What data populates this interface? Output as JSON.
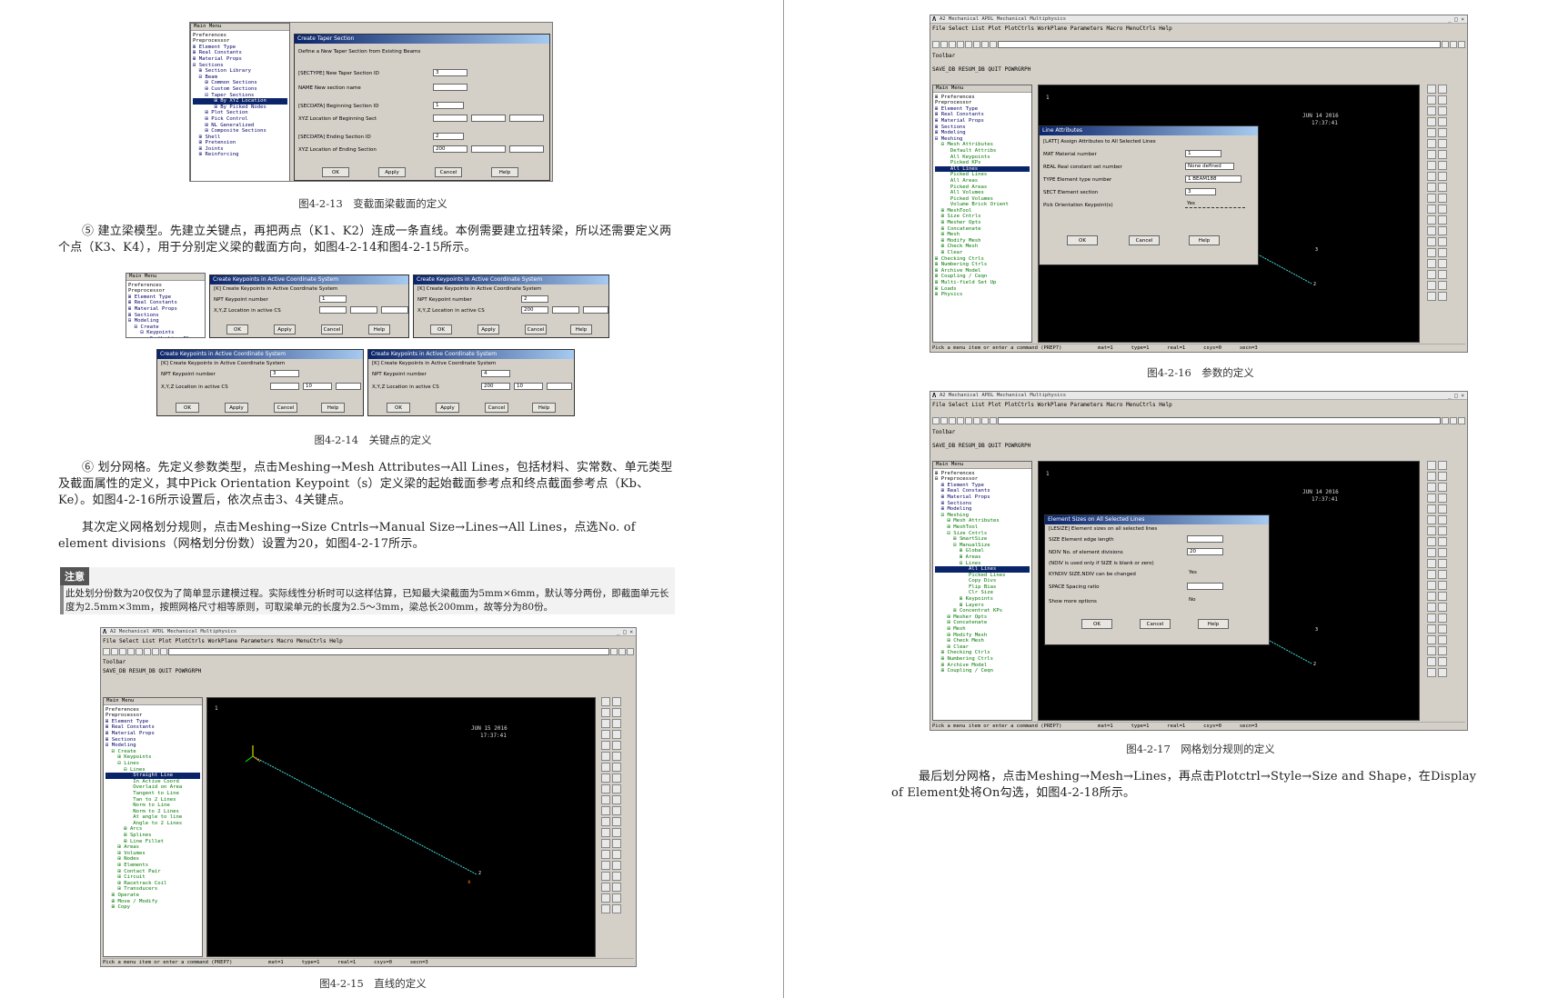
{
  "figures": {
    "f13": "图4-2-13　变截面梁截面的定义",
    "f14": "图4-2-14　关键点的定义",
    "f15": "图4-2-15　直线的定义",
    "f16": "图4-2-16　参数的定义",
    "f17": "图4-2-17　网格划分规则的定义"
  },
  "paragraphs": {
    "p5": "⑤ 建立梁模型。先建立关键点，再把两点（K1、K2）连成一条直线。本例需要建立扭转梁，所以还需要定义两个点（K3、K4），用于分别定义梁的截面方向，如图4-2-14和图4-2-15所示。",
    "p6": "⑥ 划分网格。先定义参数类型，点击Meshing→Mesh Attributes→All Lines，包括材料、实常数、单元类型及截面属性的定义，其中Pick Orientation Keypoint（s）定义梁的起始截面参考点和终点截面参考点（Kb、Ke）。如图4-2-16所示设置后，依次点击3、4关键点。",
    "p7": "其次定义网格划分规则，点击Meshing→Size Cntrls→Manual Size→Lines→All Lines，点选No. of element divisions（网格划分份数）设置为20，如图4-2-17所示。",
    "p8": "最后划分网格，点击Meshing→Mesh→Lines，再点击Plotctrl→Style→Size and Shape，在Display of Element处将On勾选，如图4-2-18所示。"
  },
  "note": {
    "tag": "注意",
    "text": "此处划分份数为20仅仅为了简单显示建模过程。实际线性分析时可以这样估算，已知最大梁截面为5mm×6mm，默认等分两份，即截面单元长度为2.5mm×3mm，按照网格尺寸相等原则，可取梁单元的长度为2.5～3mm，梁总长200mm，故等分为80份。"
  },
  "ansys": {
    "title": "A2 Mechanical APDL Mechanical Multiphysics",
    "menu": "File  Select  List  Plot  PlotCtrls  WorkPlane  Parameters  Macro  MenuCtrls  Help",
    "toolbar_label": "Toolbar",
    "toolbar_buttons": "SAVE_DB  RESUM_DB  QUIT  POWRGRPH",
    "main_menu": "Main Menu",
    "status": "Pick a menu item or enter a command  (PREP7)",
    "status_mat": "mat=1",
    "status_type": "type=1",
    "status_real": "real=1",
    "status_csys": "csys=0",
    "status_secn": "secn=3",
    "gfx_num": "1",
    "gfx_date": "JUN 14 2016",
    "gfx_date2": "JUN 15 2016",
    "gfx_time": "17:37:41"
  },
  "tree13": [
    "Preferences",
    "Preprocessor",
    "⊞ Element Type",
    "⊞ Real Constants",
    "⊞ Material Props",
    "⊟ Sections",
    "  ⊞ Section Library",
    "  ⊟ Beam",
    "    ⊞ Common Sections",
    "    ⊞ Custom Sections",
    "    ⊟ Taper Sections",
    "       ⊞ By XYZ Location",
    "       ⊞ By Picked Nodes",
    "    ⊞ Plot Section",
    "    ⊞ Pick Control",
    "    ⊞ NL Generalized",
    "    ⊞ Composite Sections",
    "  ⊞ Shell",
    "  ⊞ Pretension",
    "  ⊞ Joints",
    "  ⊞ Reinforcing"
  ],
  "dlg13": {
    "title": "Create Taper Section",
    "sub": "Define a New Taper Section from Existing Beams",
    "r1": "[SECTYPE] New Taper Section ID",
    "v1": "3",
    "r2": "NAME   New section name",
    "r3": "[SECDATA] Beginning Section ID",
    "v3": "1",
    "r4": "XYZ Location of Beginning Sect",
    "r5": "[SECDATA] Ending Section ID",
    "v5": "2",
    "r6": "XYZ Location of Ending Section",
    "v6": "200",
    "ok": "OK",
    "apply": "Apply",
    "cancel": "Cancel",
    "help": "Help"
  },
  "tree14": [
    "Preferences",
    "Preprocessor",
    "⊞ Element Type",
    "⊞ Real Constants",
    "⊞ Material Props",
    "⊞ Sections",
    "⊟ Modeling",
    "  ⊟ Create",
    "    ⊟ Keypoints",
    "       On Working Plane",
    "       In Active CS"
  ],
  "dlg14": {
    "title": "Create Keypoints in Active Coordinate System",
    "sub": "[K]  Create Keypoints in Active Coordinate System",
    "npt": "NPT   Keypoint number",
    "xyz": "X,Y,Z  Location in active CS",
    "k1": "1",
    "k2": "2",
    "k2x": "200",
    "k3": "3",
    "k3y": "10",
    "k4": "4",
    "k4x": "200",
    "k4y": "10",
    "ok": "OK",
    "apply": "Apply",
    "cancel": "Cancel",
    "help": "Help"
  },
  "tree15": [
    "Preferences",
    "Preprocessor",
    "⊞ Element Type",
    "⊞ Real Constants",
    "⊞ Material Props",
    "⊞ Sections",
    "⊟ Modeling",
    "  ⊟ Create",
    "    ⊞ Keypoints",
    "    ⊟ Lines",
    "      ⊟ Lines",
    "         Straight Line",
    "         In Active Coord",
    "         Overlaid on Area",
    "         Tangent to Line",
    "         Tan to 2 Lines",
    "         Norm to Line",
    "         Norm to 2 Lines",
    "         At angle to line",
    "         Angle to 2 Lines",
    "      ⊞ Arcs",
    "      ⊞ Splines",
    "      ⊞ Line Fillet",
    "    ⊞ Areas",
    "    ⊞ Volumes",
    "    ⊞ Nodes",
    "    ⊞ Elements",
    "    ⊞ Contact Pair",
    "    ⊞ Circuit",
    "    ⊞ Racetrack Coil",
    "    ⊞ Transducers",
    "  ⊞ Operate",
    "  ⊞ Move / Modify",
    "  ⊞ Copy"
  ],
  "tree16": [
    "⊞ Preferences",
    "Preprocessor",
    "⊞ Element Type",
    "⊞ Real Constants",
    "⊞ Material Props",
    "⊞ Sections",
    "⊞ Modeling",
    "⊟ Meshing",
    "  ⊟ Mesh Attributes",
    "     Default Attribs",
    "     All Keypoints",
    "     Picked KPs",
    "     All Lines",
    "     Picked Lines",
    "     All Areas",
    "     Picked Areas",
    "     All Volumes",
    "     Picked Volumes",
    "     Volume Brick Orient",
    "  ⊞ MeshTool",
    "  ⊞ Size Cntrls",
    "  ⊞ Mesher Opts",
    "  ⊞ Concatenate",
    "  ⊞ Mesh",
    "  ⊞ Modify Mesh",
    "  ⊞ Check Mesh",
    "  ⊞ Clear",
    "⊞ Checking Ctrls",
    "⊞ Numbering Ctrls",
    "⊞ Archive Model",
    "⊞ Coupling / Ceqn",
    "⊞ Multi-field Set Up",
    "⊞ Loads",
    "⊞ Physics"
  ],
  "dlg16": {
    "title": "Line Attributes",
    "sub": "[LATT]  Assign Attributes to All Selected Lines",
    "r1": "MAT   Material number",
    "v1": "1",
    "r2": "REAL  Real constant set number",
    "v2": "None defined",
    "r3": "TYPE  Element type number",
    "v3": "1  BEAM188",
    "r4": "SECT  Element section",
    "v4": "3",
    "r5": "Pick Orientation Keypoint(s)",
    "v5": "Yes",
    "ok": "OK",
    "cancel": "Cancel",
    "help": "Help"
  },
  "tree17": [
    "⊞ Preferences",
    "⊟ Preprocessor",
    "  ⊞ Element Type",
    "  ⊞ Real Constants",
    "  ⊞ Material Props",
    "  ⊞ Sections",
    "  ⊞ Modeling",
    "  ⊟ Meshing",
    "    ⊞ Mesh Attributes",
    "    ⊞ MeshTool",
    "    ⊟ Size Cntrls",
    "      ⊞ SmartSize",
    "      ⊟ ManualSize",
    "        ⊞ Global",
    "        ⊞ Areas",
    "        ⊟ Lines",
    "           All Lines",
    "           Picked Lines",
    "           Copy Divs",
    "           Flip Bias",
    "           Clr Size",
    "        ⊞ Keypoints",
    "        ⊞ Layers",
    "      ⊞ Concentrat KPs",
    "    ⊞ Mesher Opts",
    "    ⊞ Concatenate",
    "    ⊞ Mesh",
    "    ⊞ Modify Mesh",
    "    ⊞ Check Mesh",
    "    ⊞ Clear",
    "  ⊞ Checking Ctrls",
    "  ⊞ Numbering Ctrls",
    "  ⊞ Archive Model",
    "  ⊞ Coupling / Ceqn"
  ],
  "dlg17": {
    "title": "Element Sizes on All Selected Lines",
    "sub": "[LESIZE] Element sizes on all selected lines",
    "r1": "SIZE   Element edge length",
    "r2": "NDIV   No. of element divisions",
    "v2": "20",
    "r3": "(NDIV is used only if SIZE is blank or zero)",
    "r4": "KYNDIV SIZE,NDIV can be changed",
    "v4": "Yes",
    "r5": "SPACE  Spacing ratio",
    "r6": "Show more options",
    "v6": "No",
    "ok": "OK",
    "cancel": "Cancel",
    "help": "Help"
  }
}
